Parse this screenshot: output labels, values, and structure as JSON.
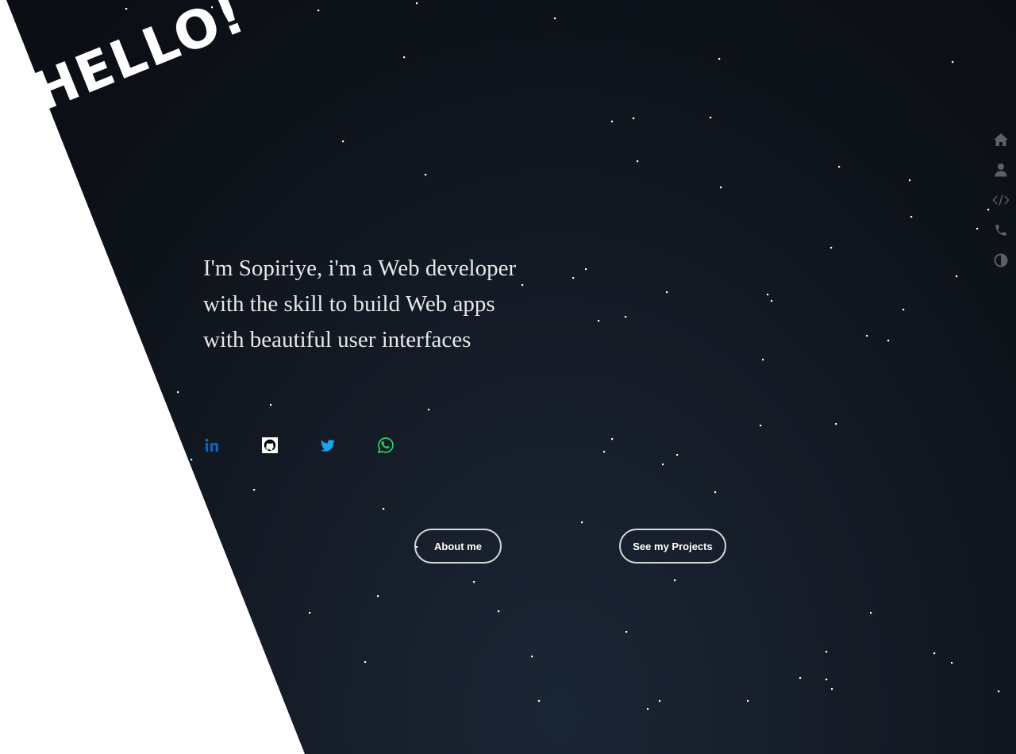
{
  "hero": {
    "greeting": "HELLO!",
    "intro": "I'm Sopiriye, i'm a Web developer with the skill to build Web apps with beautiful user interfaces"
  },
  "socials": [
    {
      "icon": "linkedin-icon",
      "color": "#0a66c2"
    },
    {
      "icon": "github-icon",
      "color": "#ffffff"
    },
    {
      "icon": "twitter-icon",
      "color": "#1da1f2"
    },
    {
      "icon": "whatsapp-icon",
      "color": "#25d366"
    }
  ],
  "buttons": {
    "about": "About me",
    "projects": "See my Projects"
  },
  "sidenav": [
    {
      "icon": "home-icon"
    },
    {
      "icon": "user-icon"
    },
    {
      "icon": "code-icon"
    },
    {
      "icon": "phone-icon"
    },
    {
      "icon": "contrast-icon"
    }
  ],
  "colors": {
    "background": "#0d1118",
    "wedge": "#ffffff",
    "text": "#e8e8e8",
    "nav_icon": "#5c5f66"
  }
}
